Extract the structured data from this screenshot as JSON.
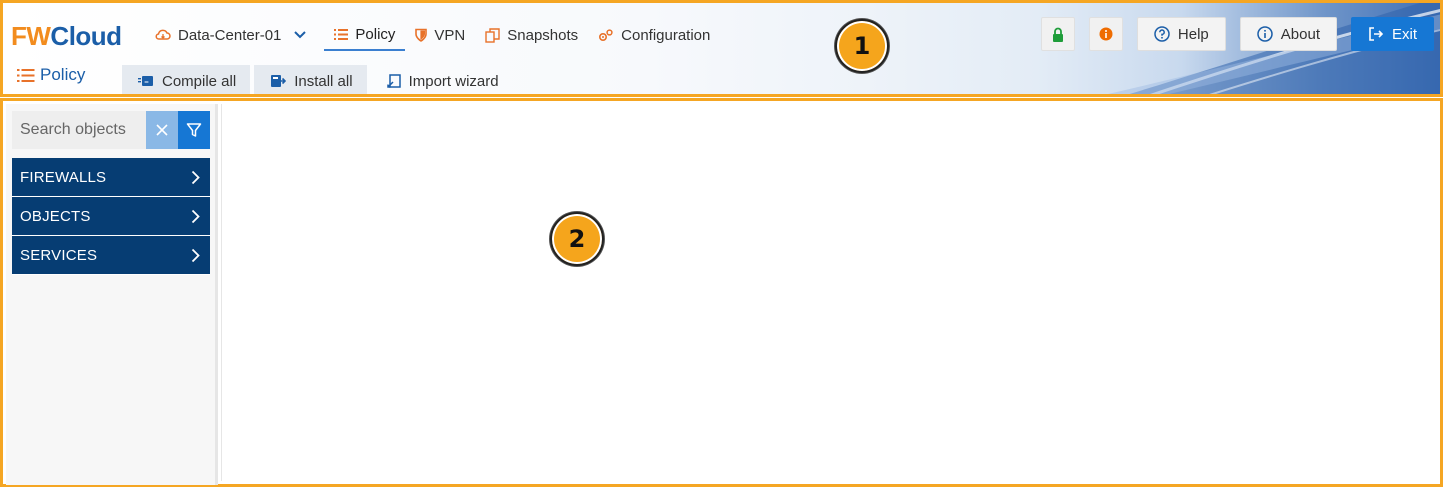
{
  "header": {
    "logo": {
      "part1": "FW",
      "part2": "Cloud"
    },
    "datacenter": {
      "label": "Data-Center-01"
    },
    "nav": [
      {
        "label": "Policy",
        "active": true,
        "icon": "list-icon"
      },
      {
        "label": "VPN",
        "active": false,
        "icon": "shield-icon"
      },
      {
        "label": "Snapshots",
        "active": false,
        "icon": "snapshot-icon"
      },
      {
        "label": "Configuration",
        "active": false,
        "icon": "gears-icon"
      }
    ],
    "section_title": "Policy",
    "toolbar": {
      "compile_all": "Compile all",
      "install_all": "Install all",
      "import_wizard": "Import wizard"
    },
    "controls": {
      "help": "Help",
      "about": "About",
      "exit": "Exit"
    }
  },
  "sidebar": {
    "search_placeholder": "Search objects",
    "items": [
      {
        "label": "FIREWALLS"
      },
      {
        "label": "OBJECTS"
      },
      {
        "label": "SERVICES"
      }
    ]
  },
  "annotations": {
    "marker1": "1",
    "marker2": "2"
  },
  "colors": {
    "accent": "#1677d4",
    "brand_orange": "#f28c1e",
    "brand_blue": "#1b5ea8",
    "tree_bg": "#063d73",
    "highlight_border": "#f5a623",
    "lock_green": "#1f9d3a",
    "info_orange": "#ef6c00"
  }
}
